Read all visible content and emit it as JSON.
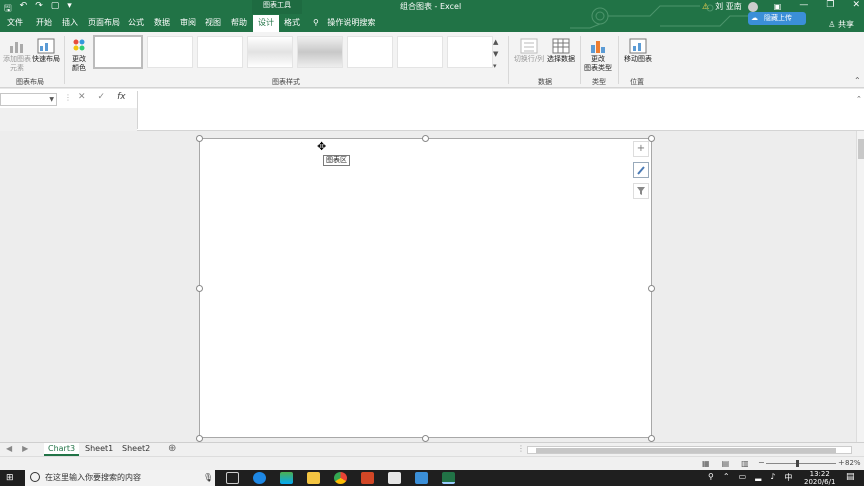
{
  "titlebar": {
    "context_tab": "图表工具",
    "doc_title": "组合图表 - Excel",
    "user_name": "刘 亚南",
    "upload_label": "隐藏上传"
  },
  "tabs": {
    "items": [
      "文件",
      "开始",
      "插入",
      "页面布局",
      "公式",
      "数据",
      "审阅",
      "视图",
      "帮助",
      "设计",
      "格式"
    ],
    "active": "设计",
    "tell_me": "操作说明搜索",
    "share": "共享"
  },
  "ribbon": {
    "add_element": "添加图表\n元素",
    "quick_layout": "快速布局",
    "layout_group": "图表布局",
    "change_colors": "更改\n颜色",
    "styles_group": "图表样式",
    "switch_rowcol": "切换行/列",
    "select_data": "选择数据",
    "data_group": "数据",
    "change_type": "更改\n图表类型",
    "type_group": "类型",
    "move_chart": "移动图表",
    "location_group": "位置"
  },
  "formula": {
    "cancel": "✕",
    "enter": "✓",
    "fx": "fx",
    "value": ""
  },
  "chart": {
    "tooltip": "图表区",
    "plus_icon": "+",
    "brush_icon": "brush",
    "filter_icon": "filter"
  },
  "sheets": {
    "tabs": [
      "Chart3",
      "Sheet1",
      "Sheet2"
    ],
    "active": "Chart3",
    "add": "⊕"
  },
  "status": {
    "zoom": "82%"
  },
  "taskbar": {
    "search_placeholder": "在这里输入你要搜索的内容",
    "time": "13:22",
    "date": "2020/6/1"
  },
  "colors": {
    "excel_green": "#217346",
    "upload_blue": "#3b8fd8"
  }
}
